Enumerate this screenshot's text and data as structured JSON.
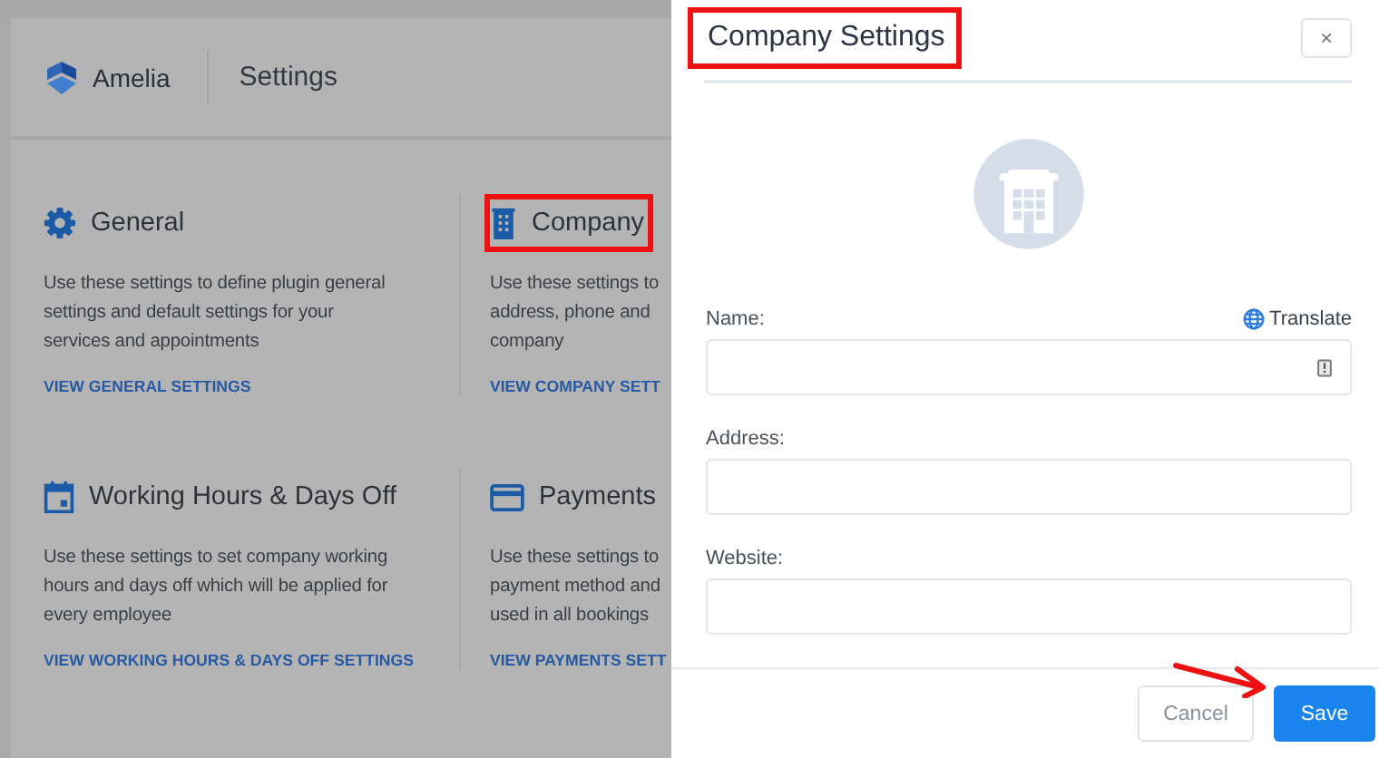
{
  "header": {
    "brand": "Amelia",
    "title": "Settings"
  },
  "cards": [
    {
      "kind": "gear",
      "title": "General",
      "highlighted": false,
      "lines": [
        "Use these settings to define plugin general",
        "settings and default settings for your",
        "services and appointments"
      ],
      "link": "VIEW GENERAL SETTINGS"
    },
    {
      "kind": "building",
      "title": "Company",
      "highlighted": true,
      "lines": [
        "Use these settings to",
        "address, phone and",
        "company"
      ],
      "link": "VIEW COMPANY SETT"
    },
    {
      "kind": "calendar",
      "title": "Working Hours & Days Off",
      "highlighted": false,
      "lines": [
        "Use these settings to set company working",
        "hours and days off which will be applied for",
        "every employee"
      ],
      "link": "VIEW WORKING HOURS & DAYS OFF SETTINGS"
    },
    {
      "kind": "card",
      "title": "Payments",
      "highlighted": false,
      "lines": [
        "Use these settings to",
        "payment method and",
        "used in all bookings"
      ],
      "link": "VIEW PAYMENTS SETT"
    }
  ],
  "dialog": {
    "title": "Company Settings",
    "title_highlighted": true,
    "close": "×",
    "fields": [
      {
        "label": "Name:",
        "action": "Translate",
        "kind": "name"
      },
      {
        "label": "Address:",
        "kind": "text"
      },
      {
        "label": "Website:",
        "kind": "text"
      }
    ],
    "buttons": [
      {
        "label": "Cancel",
        "kind": "secondary"
      },
      {
        "label": "Save",
        "kind": "primary"
      }
    ],
    "save_arrow": true
  }
}
